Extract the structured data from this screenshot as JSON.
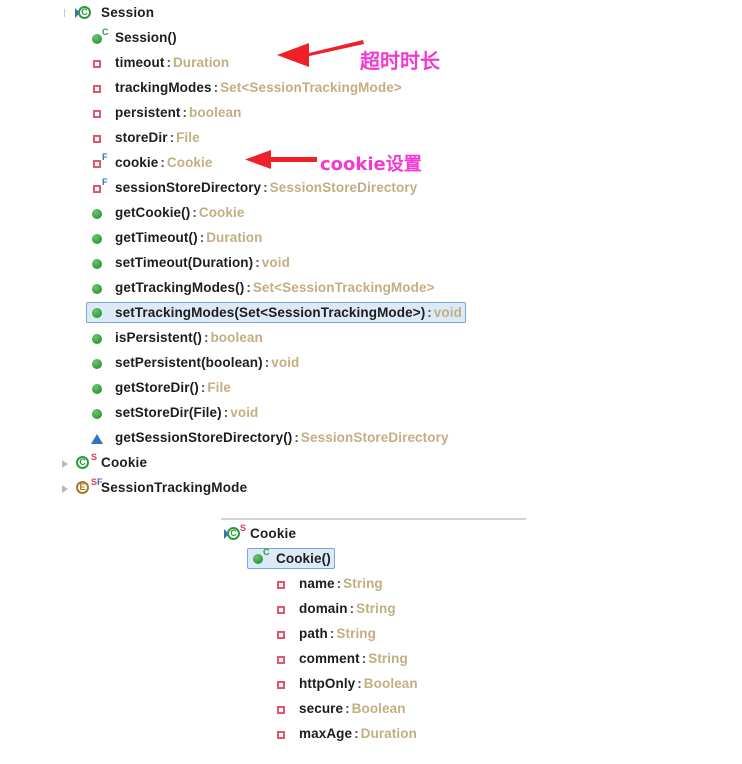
{
  "outline": {
    "root": {
      "label": "Session",
      "icon": "class-icon",
      "caret": "expanded"
    },
    "members": [
      {
        "icon": "constructor-icon",
        "badge": "C",
        "name": "Session()",
        "type": "",
        "selected": false
      },
      {
        "icon": "field-icon",
        "badge": "",
        "name": "timeout",
        "type": "Duration",
        "selected": false
      },
      {
        "icon": "field-icon",
        "badge": "",
        "name": "trackingModes",
        "type": "Set<SessionTrackingMode>",
        "selected": false
      },
      {
        "icon": "field-icon",
        "badge": "",
        "name": "persistent",
        "type": "boolean",
        "selected": false
      },
      {
        "icon": "field-icon",
        "badge": "",
        "name": "storeDir",
        "type": "File",
        "selected": false
      },
      {
        "icon": "field-icon",
        "badge": "F",
        "name": "cookie",
        "type": "Cookie",
        "selected": false
      },
      {
        "icon": "field-icon",
        "badge": "F",
        "name": "sessionStoreDirectory",
        "type": "SessionStoreDirectory",
        "selected": false
      },
      {
        "icon": "method-icon",
        "badge": "",
        "name": "getCookie()",
        "type": "Cookie",
        "selected": false
      },
      {
        "icon": "method-icon",
        "badge": "",
        "name": "getTimeout()",
        "type": "Duration",
        "selected": false
      },
      {
        "icon": "method-icon",
        "badge": "",
        "name": "setTimeout(Duration)",
        "type": "void",
        "selected": false
      },
      {
        "icon": "method-icon",
        "badge": "",
        "name": "getTrackingModes()",
        "type": "Set<SessionTrackingMode>",
        "selected": false
      },
      {
        "icon": "method-icon",
        "badge": "",
        "name": "setTrackingModes(Set<SessionTrackingMode>)",
        "type": "void",
        "selected": true
      },
      {
        "icon": "method-icon",
        "badge": "",
        "name": "isPersistent()",
        "type": "boolean",
        "selected": false
      },
      {
        "icon": "method-icon",
        "badge": "",
        "name": "setPersistent(boolean)",
        "type": "void",
        "selected": false
      },
      {
        "icon": "method-icon",
        "badge": "",
        "name": "getStoreDir()",
        "type": "File",
        "selected": false
      },
      {
        "icon": "method-icon",
        "badge": "",
        "name": "setStoreDir(File)",
        "type": "void",
        "selected": false
      },
      {
        "icon": "inherited-triangle-icon",
        "badge": "",
        "name": "getSessionStoreDirectory()",
        "type": "SessionStoreDirectory",
        "selected": false
      }
    ],
    "nested": [
      {
        "icon": "class-icon",
        "badges": "S",
        "label": "Cookie",
        "caret": "collapsed"
      },
      {
        "icon": "enum-icon",
        "badges": "SF",
        "label": "SessionTrackingMode",
        "caret": "collapsed"
      }
    ]
  },
  "member_panel": {
    "root": {
      "label": "Cookie",
      "icon": "class-icon",
      "badge": "S"
    },
    "members": [
      {
        "icon": "constructor-icon",
        "badge": "C",
        "name": "Cookie()",
        "type": "",
        "selected": true
      },
      {
        "icon": "field-icon",
        "badge": "",
        "name": "name",
        "type": "String",
        "selected": false
      },
      {
        "icon": "field-icon",
        "badge": "",
        "name": "domain",
        "type": "String",
        "selected": false
      },
      {
        "icon": "field-icon",
        "badge": "",
        "name": "path",
        "type": "String",
        "selected": false
      },
      {
        "icon": "field-icon",
        "badge": "",
        "name": "comment",
        "type": "String",
        "selected": false
      },
      {
        "icon": "field-icon",
        "badge": "",
        "name": "httpOnly",
        "type": "Boolean",
        "selected": false
      },
      {
        "icon": "field-icon",
        "badge": "",
        "name": "secure",
        "type": "Boolean",
        "selected": false
      },
      {
        "icon": "field-icon",
        "badge": "",
        "name": "maxAge",
        "type": "Duration",
        "selected": false
      }
    ]
  },
  "annotations": [
    {
      "id": "annot-timeout",
      "text": "超时时长",
      "color": "#f23ad2",
      "arrow": "red-left-arrow"
    },
    {
      "id": "annot-cookie",
      "text": "cookie设置",
      "color": "#f23ad2",
      "arrow": "red-left-arrow"
    }
  ],
  "colors": {
    "member_name": "#1d1d1d",
    "member_type": "#c2ae81",
    "selection_bg": "#dce9f7",
    "selection_border": "#7aa8d6",
    "annotation": "#f23ad2",
    "arrow": "#f01f28",
    "class_icon_green": "#2d9c3c",
    "enum_icon_brown": "#a77a2a",
    "field_icon_red": "#e2566e"
  },
  "separator": {
    "visible": true
  }
}
